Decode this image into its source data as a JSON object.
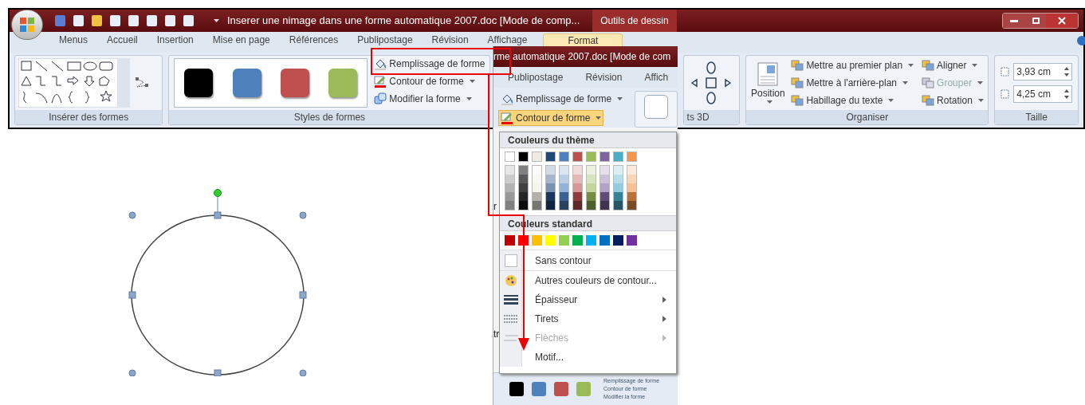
{
  "window": {
    "title": "Inserer une nimage dans une forme automatique 2007.doc [Mode de comp...",
    "context_tab": "Outils de dessin"
  },
  "tabs": [
    {
      "label": "Menus",
      "selected": false
    },
    {
      "label": "Accueil",
      "selected": false
    },
    {
      "label": "Insertion",
      "selected": false
    },
    {
      "label": "Mise en page",
      "selected": false
    },
    {
      "label": "Références",
      "selected": false
    },
    {
      "label": "Publipostage",
      "selected": false
    },
    {
      "label": "Révision",
      "selected": false
    },
    {
      "label": "Affichage",
      "selected": false
    },
    {
      "label": "Format",
      "selected": true
    }
  ],
  "insert_shapes": {
    "label": "Insérer des formes"
  },
  "shape_styles": {
    "label": "Styles de formes",
    "swatches": [
      {
        "color": "#000000"
      },
      {
        "color": "#4f81bd"
      },
      {
        "color": "#c0504d"
      },
      {
        "color": "#9bbb59"
      }
    ],
    "commands": [
      "Remplissage de forme",
      "Contour de forme",
      "Modifier la forme"
    ]
  },
  "overlay": {
    "title": "rme automatique 2007.doc [Mode de com",
    "tabs": [
      "Publipostage",
      "Révision",
      "Affich"
    ],
    "commands": [
      {
        "label": "Remplissage de forme",
        "selected": false
      },
      {
        "label": "Contour de forme",
        "selected": true
      }
    ],
    "fragments": [
      "r",
      "tr"
    ],
    "menu": {
      "theme_header": "Couleurs du thème",
      "theme_colors": [
        {
          "color": "#ffffff"
        },
        {
          "color": "#000000"
        },
        {
          "color": "#eeece1"
        },
        {
          "color": "#1f497d"
        },
        {
          "color": "#4f81bd"
        },
        {
          "color": "#c0504d"
        },
        {
          "color": "#9bbb59"
        },
        {
          "color": "#8064a2"
        },
        {
          "color": "#4bacc6"
        },
        {
          "color": "#f79646"
        }
      ],
      "standard_header": "Couleurs standard",
      "standard_colors": [
        {
          "color": "#c00000"
        },
        {
          "color": "#ff0000"
        },
        {
          "color": "#ffc000"
        },
        {
          "color": "#ffff00"
        },
        {
          "color": "#92d050"
        },
        {
          "color": "#00b050"
        },
        {
          "color": "#00b0f0"
        },
        {
          "color": "#0070c0"
        },
        {
          "color": "#002060"
        },
        {
          "color": "#7030a0"
        }
      ],
      "items": [
        {
          "kind": "none",
          "label": "Sans contour",
          "disabled": false,
          "submenu": false
        },
        {
          "kind": "palette",
          "label": "Autres couleurs de contour...",
          "disabled": false,
          "submenu": false
        },
        {
          "kind": "weight",
          "label": "Épaisseur",
          "disabled": false,
          "submenu": true
        },
        {
          "kind": "dashes",
          "label": "Tirets",
          "disabled": false,
          "submenu": true
        },
        {
          "kind": "arrows",
          "label": "Flèches",
          "disabled": true,
          "submenu": true
        },
        {
          "kind": "plain",
          "label": "Motif...",
          "disabled": false,
          "submenu": false
        }
      ]
    },
    "bottom": {
      "swatches": [
        {
          "color": "#000000"
        },
        {
          "color": "#4f81bd"
        },
        {
          "color": "#c0504d"
        },
        {
          "color": "#9bbb59"
        }
      ],
      "commands": [
        "Remplissage de forme",
        "Contour de forme",
        "Modifier la forme"
      ]
    }
  },
  "rotation_3d": {
    "label": "ts 3D"
  },
  "arrange": {
    "label": "Organiser",
    "position": "Position",
    "commands": [
      {
        "label": "Mettre au premier plan",
        "disabled": false
      },
      {
        "label": "Mettre à l'arrière-plan",
        "disabled": false
      },
      {
        "label": "Habillage du texte",
        "disabled": false
      },
      {
        "label": "Aligner",
        "disabled": false
      },
      {
        "label": "Grouper",
        "disabled": true
      },
      {
        "label": "Rotation",
        "disabled": false
      }
    ]
  },
  "size": {
    "label": "Taille",
    "height": "3,93 cm",
    "width": "4,25 cm"
  }
}
